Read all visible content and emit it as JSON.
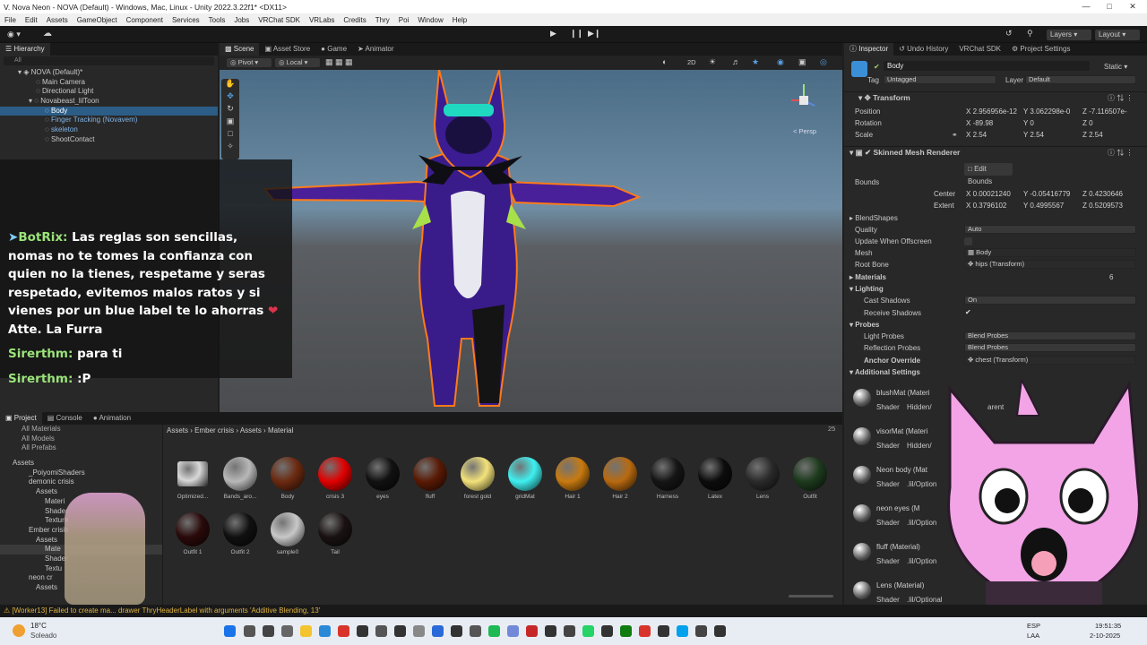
{
  "window": {
    "title": "V. Nova Neon - NOVA (Default) - Windows, Mac, Linux - Unity 2022.3.22f1* <DX11>"
  },
  "menu": [
    "File",
    "Edit",
    "Assets",
    "GameObject",
    "Component",
    "Services",
    "Tools",
    "Jobs",
    "VRChat SDK",
    "VRLabs",
    "Credits",
    "Thry",
    "Poi",
    "Window",
    "Help"
  ],
  "toolbar": {
    "layers": "Layers",
    "layout": "Layout"
  },
  "hierarchy": {
    "tab": "Hierarchy",
    "search_placeholder": "All",
    "rows": [
      "NOVA (Default)*",
      "Main Camera",
      "Directional Light",
      "Novabeast_lilToon",
      "Body",
      "Finger Tracking (Novavem)",
      "skeleton",
      "ShootContact"
    ]
  },
  "scene": {
    "tabs": [
      "Scene",
      "Asset Store",
      "Game",
      "Animator"
    ],
    "pivot": "Pivot",
    "local": "Local",
    "mode2d": "2D",
    "persp": "< Persp"
  },
  "chat": {
    "messages": [
      {
        "name": "BotRix:",
        "text": "Las reglas son sencillas, nomas no te tomes la confianza con quien no la tienes, respetame y seras respetado, evitemos malos ratos y si vienes por un blue label te lo ahorras",
        "tail": "Atte. La Furra"
      },
      {
        "name": "Sirerthm:",
        "text": "para ti"
      },
      {
        "name": "Sirerthm:",
        "text": ":P"
      }
    ]
  },
  "project": {
    "tabs": [
      "Project",
      "Console",
      "Animation"
    ],
    "favorites": [
      "All Materials",
      "All Models",
      "All Prefabs"
    ],
    "tree": [
      "Assets",
      "_PoiyomiShaders",
      "demonic crisis",
      "Assets",
      "Materi",
      "Shader",
      "Texture",
      "Ember crisis",
      "Assets",
      "Mate",
      "Shader",
      "Textu",
      "neon cr",
      "Assets"
    ],
    "breadcrumb": [
      "Assets",
      "Ember crisis",
      "Assets",
      "Material"
    ],
    "count": "25",
    "assets": [
      {
        "label": "Optimized...",
        "color": "#d8d8d8"
      },
      {
        "label": "Bands_aro...",
        "color": "#b8b8b8"
      },
      {
        "label": "Body",
        "color": "#6b2a10"
      },
      {
        "label": "crisis 3",
        "color": "#e10000"
      },
      {
        "label": "eyes",
        "color": "#111111"
      },
      {
        "label": "fluff",
        "color": "#5a1a05"
      },
      {
        "label": "forest gold",
        "color": "#f3e27a"
      },
      {
        "label": "gridMat",
        "color": "#3ff0f0"
      },
      {
        "label": "Hair 1",
        "color": "#c87a10"
      },
      {
        "label": "Hair 2",
        "color": "#b86a10"
      },
      {
        "label": "Harness",
        "color": "#151515"
      },
      {
        "label": "Latex",
        "color": "#0c0c0c"
      },
      {
        "label": "Lens",
        "color": "#2a2a2a"
      },
      {
        "label": "Outfit",
        "color": "#1d3a1d"
      },
      {
        "label": "Outfit 1",
        "color": "#2a0a0a"
      },
      {
        "label": "Outfit 2",
        "color": "#101010"
      },
      {
        "label": "sample0",
        "color": "#c8c8c8"
      },
      {
        "label": "Tail",
        "color": "#1a1212"
      }
    ]
  },
  "console_error": "[Worker13] Failed to create ma... drawer ThryHeaderLabel with arguments 'Additive Blending, 13'",
  "inspector": {
    "tabs": [
      "Inspector",
      "Undo History",
      "VRChat SDK",
      "Project Settings"
    ],
    "object_name": "Body",
    "static": "Static",
    "tag_label": "Tag",
    "tag": "Untagged",
    "layer_label": "Layer",
    "layer": "Default",
    "transform": {
      "title": "Transform",
      "position": {
        "label": "Position",
        "x": "2.956956e-12",
        "y": "3.062298e-0",
        "z": "-7.116507e-"
      },
      "rotation": {
        "label": "Rotation",
        "x": "-89.98",
        "y": "0",
        "z": "0"
      },
      "scale": {
        "label": "Scale",
        "x": "2.54",
        "y": "2.54",
        "z": "2.54"
      }
    },
    "smr": {
      "title": "Skinned Mesh Renderer",
      "edit_bounds": "Edit Bounds",
      "bounds": "Bounds",
      "center": {
        "label": "Center",
        "x": "0.00021240",
        "y": "-0.05416779",
        "z": "0.4230646"
      },
      "extent": {
        "label": "Extent",
        "x": "0.3796102",
        "y": "0.4995567",
        "z": "0.5209573"
      },
      "blendshapes": "BlendShapes",
      "quality": {
        "label": "Quality",
        "value": "Auto"
      },
      "update_offscreen": "Update When Offscreen",
      "mesh": {
        "label": "Mesh",
        "value": "Body"
      },
      "root_bone": {
        "label": "Root Bone",
        "value": "hips (Transform)"
      },
      "materials": {
        "label": "Materials",
        "count": "6"
      },
      "lighting": "Lighting",
      "cast_shadows": {
        "label": "Cast Shadows",
        "value": "On"
      },
      "receive_shadows": "Receive Shadows",
      "probes": "Probes",
      "light_probes": {
        "label": "Light Probes",
        "value": "Blend Probes"
      },
      "reflection_probes": {
        "label": "Reflection Probes",
        "value": "Blend Probes"
      },
      "anchor_override": {
        "label": "Anchor Override",
        "value": "chest (Transform)"
      },
      "additional": "Additional Settings"
    },
    "materials": [
      {
        "name": "blushMat (Materi",
        "shader": "Shader",
        "shader_value": "Hidden/",
        "extra": "arent"
      },
      {
        "name": "visorMat (Materi",
        "shader": "Shader",
        "shader_value": "Hidden/"
      },
      {
        "name": "Neon body (Mat",
        "shader": "Shader",
        "shader_value": ".lil/Option"
      },
      {
        "name": "neon eyes (M",
        "shader": "Shader",
        "shader_value": ".lil/Option"
      },
      {
        "name": "fluff (Material)",
        "shader": "Shader",
        "shader_value": ".lil/Option"
      },
      {
        "name": "Lens (Material)",
        "shader": "Shader",
        "shader_value": ".lil/Optional"
      }
    ]
  },
  "taskbar": {
    "weather_temp": "18°C",
    "weather_desc": "Soleado",
    "lang1": "ESP",
    "lang2": "LAA",
    "time": "19:51:35",
    "date": "2-10-2025"
  }
}
